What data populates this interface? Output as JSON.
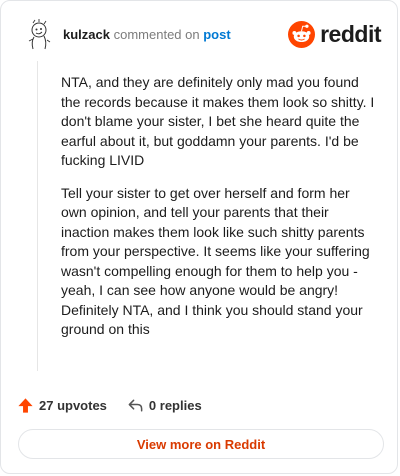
{
  "comment": {
    "username": "kulzack",
    "action_text": "commented on",
    "post_link_text": "post",
    "paragraphs": [
      "NTA, and they are definitely only mad you found the records because it makes them look so shitty. I don't blame your sister, I bet she heard quite the earful about it, but goddamn your parents. I'd be fucking LIVID",
      "Tell your sister to get over herself and form her own opinion, and tell your parents that their inaction makes them look like such shitty parents from your perspective. It seems like your suffering wasn't compelling enough for them to help you - yeah, I can see how anyone would be angry! Definitely NTA, and I think you should stand your ground on this"
    ]
  },
  "brand": {
    "wordmark": "reddit",
    "logo_icon": "reddit-snoo-icon",
    "accent_color": "#ff4500"
  },
  "footer": {
    "upvotes_label": "27 upvotes",
    "replies_label": "0 replies",
    "upvote_icon": "upvote-arrow-icon",
    "reply_icon": "reply-arrow-icon"
  },
  "view_more_label": "View more on Reddit"
}
